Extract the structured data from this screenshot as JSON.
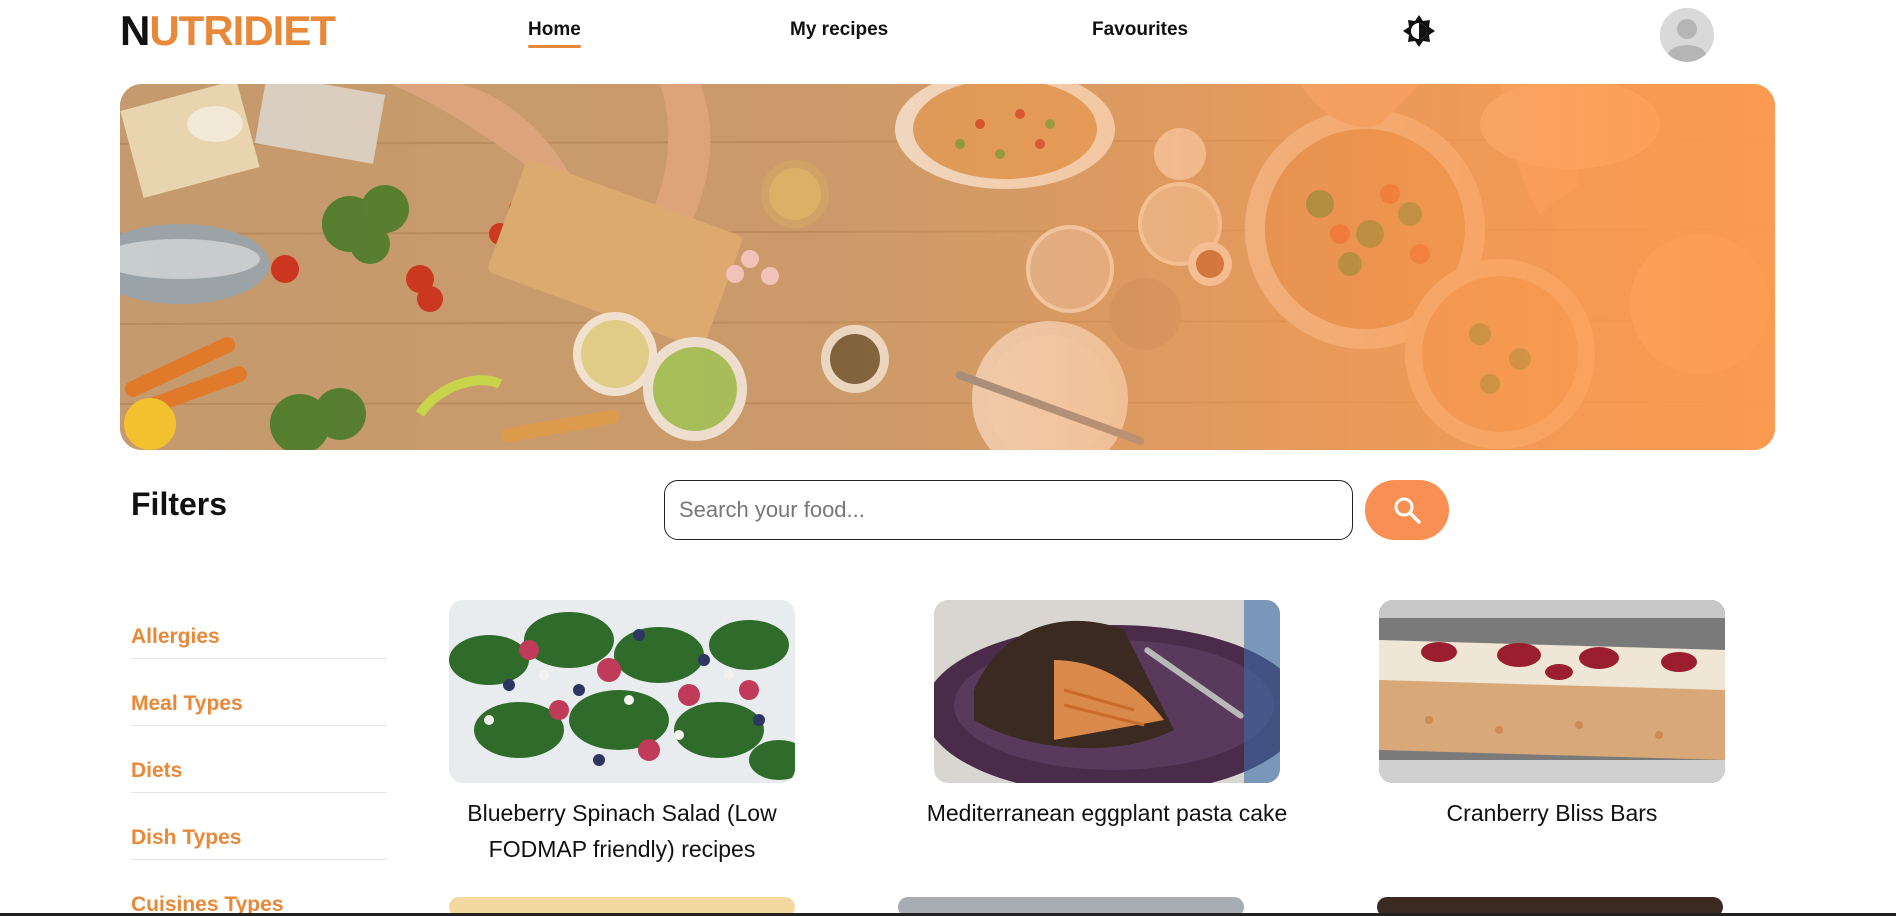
{
  "header": {
    "logo_first": "N",
    "logo_rest": "UTRIDIET",
    "nav": [
      {
        "label": "Home",
        "active": true
      },
      {
        "label": "My recipes",
        "active": false
      },
      {
        "label": "Favourites",
        "active": false
      }
    ],
    "theme_icon": "brightness-icon",
    "avatar_icon": "user-avatar-icon"
  },
  "hero": {
    "image": "cooking-table-photo"
  },
  "filters": {
    "title": "Filters",
    "categories": [
      "Allergies",
      "Meal Types",
      "Diets",
      "Dish Types",
      "Cuisines Types"
    ]
  },
  "search": {
    "placeholder": "Search your food...",
    "value": "",
    "icon": "search-icon"
  },
  "recipes": [
    {
      "title": "Blueberry Spinach Salad (Low FODMAP friendly) recipes"
    },
    {
      "title": "Mediterranean eggplant pasta cake"
    },
    {
      "title": "Cranberry Bliss Bars"
    }
  ],
  "colors": {
    "accent": "#e8893a",
    "search_button": "#f98f52",
    "hero_overlay": "#ff9a4e"
  }
}
